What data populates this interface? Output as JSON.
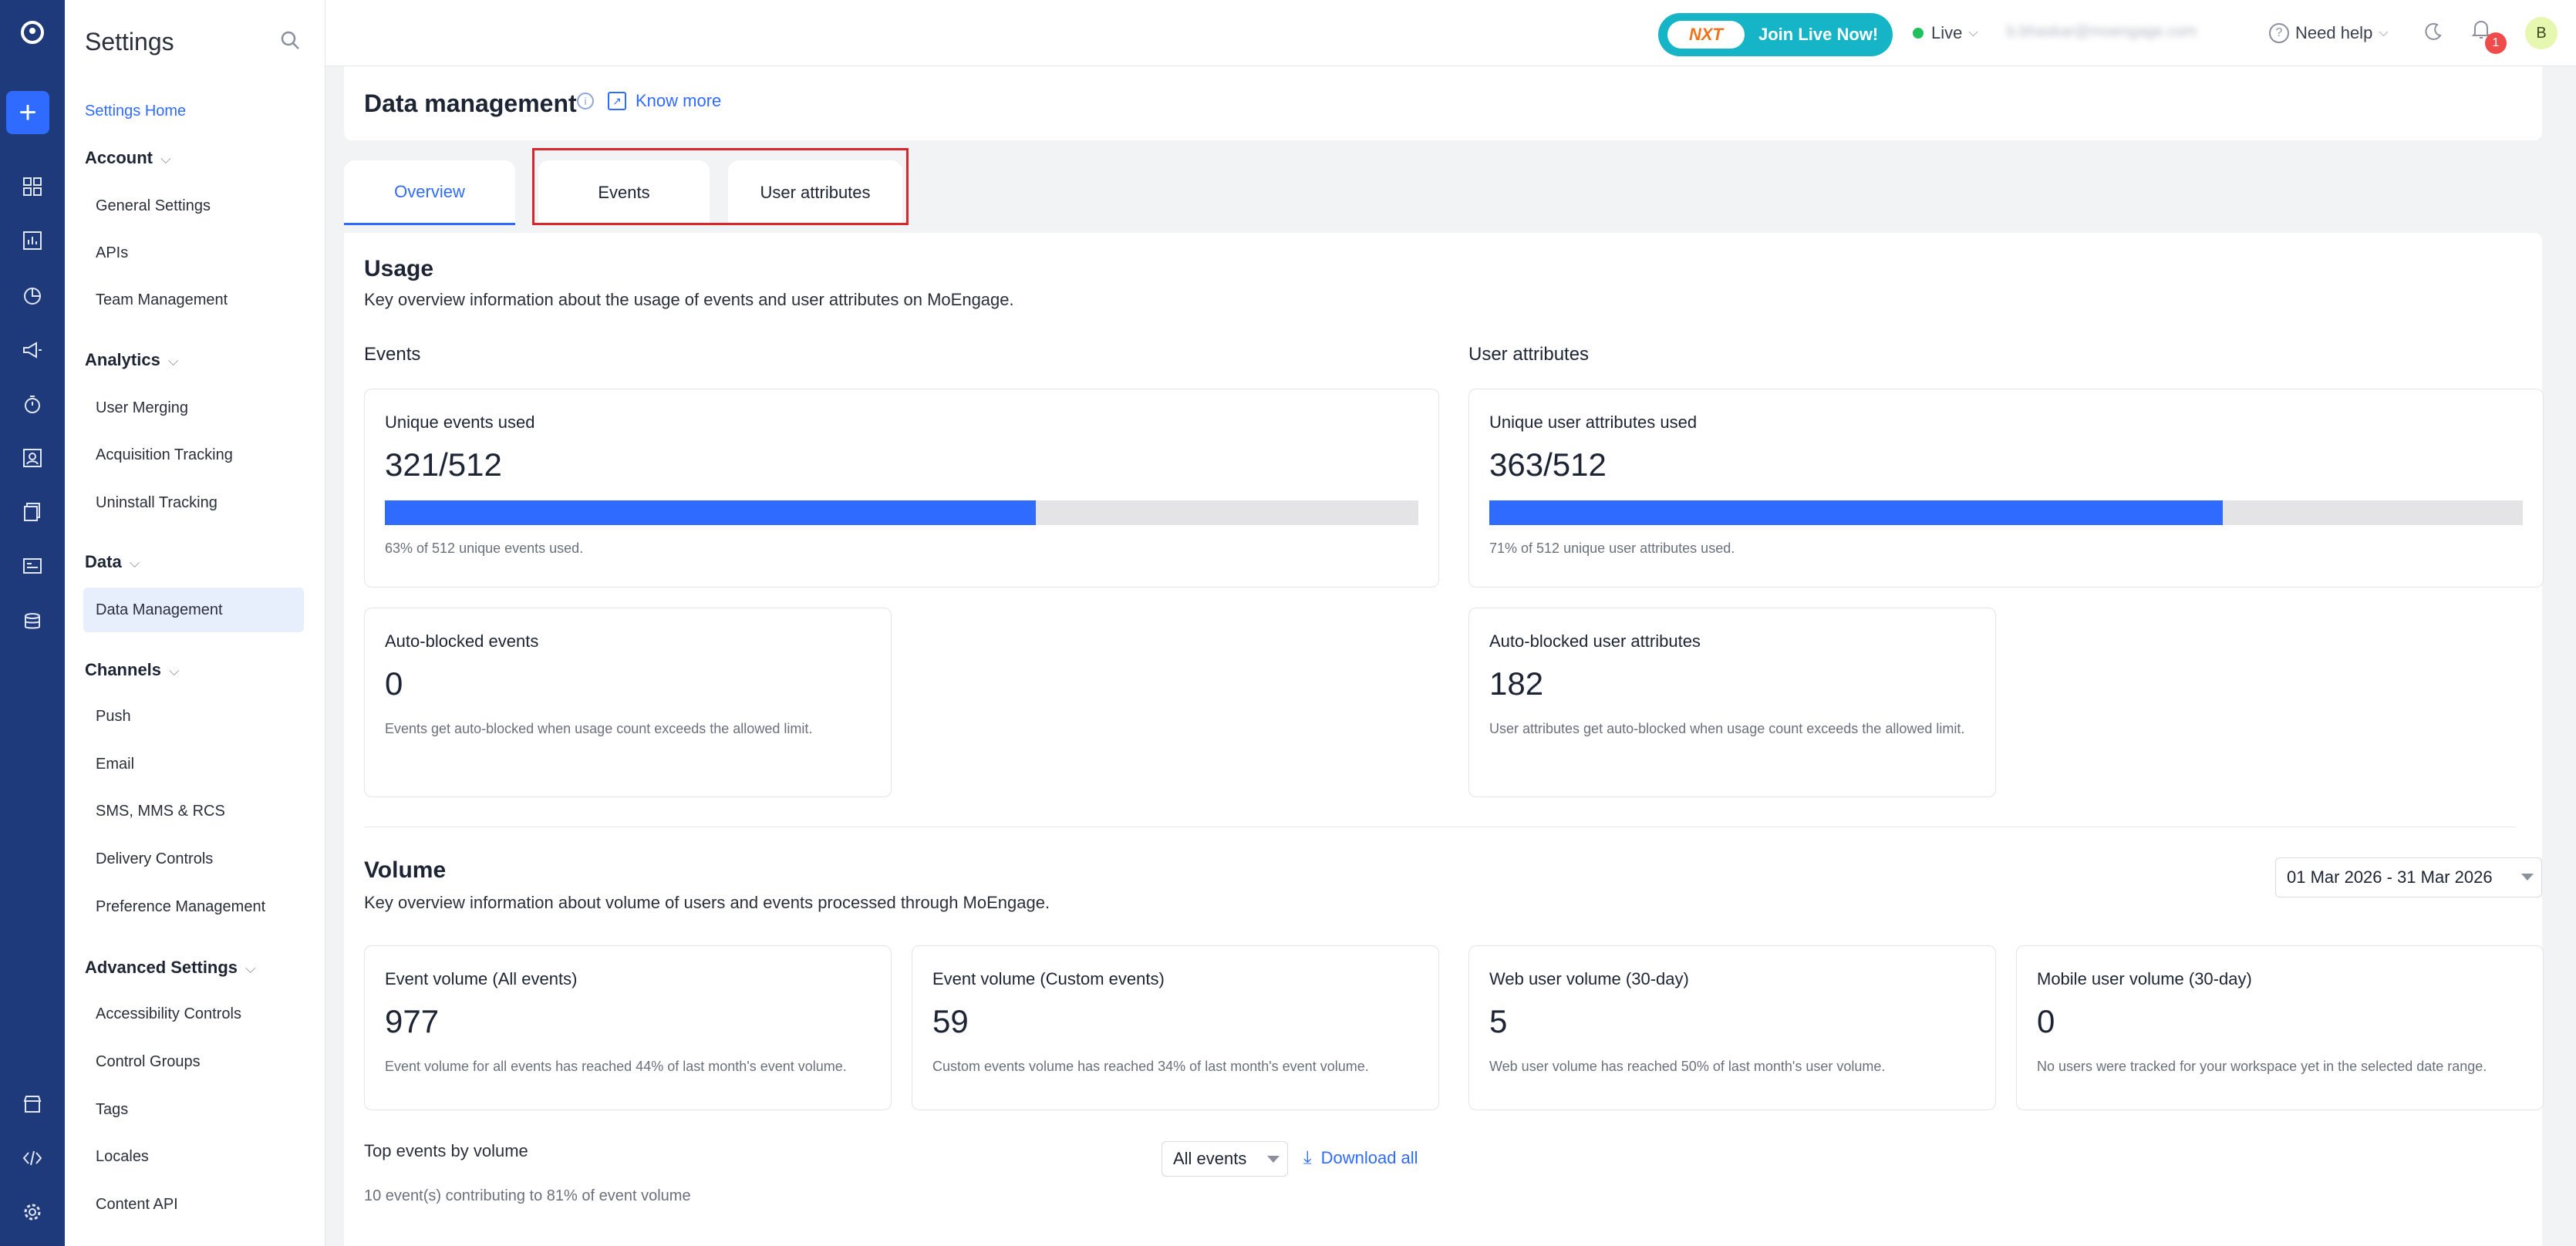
{
  "sidebar": {
    "title": "Settings",
    "home": "Settings Home",
    "sections": [
      {
        "label": "Account",
        "items": [
          "General Settings",
          "APIs",
          "Team Management"
        ]
      },
      {
        "label": "Analytics",
        "items": [
          "User Merging",
          "Acquisition Tracking",
          "Uninstall Tracking"
        ]
      },
      {
        "label": "Data",
        "items": [
          "Data Management"
        ]
      },
      {
        "label": "Channels",
        "items": [
          "Push",
          "Email",
          "SMS, MMS & RCS",
          "Delivery Controls",
          "Preference Management"
        ]
      },
      {
        "label": "Advanced Settings",
        "items": [
          "Accessibility Controls",
          "Control Groups",
          "Tags",
          "Locales",
          "Content API"
        ]
      }
    ]
  },
  "topbar": {
    "next_label": "NXT",
    "join_label": "Join Live Now!",
    "env_label": "Live",
    "account_label": "b.bhaskar@moengage.com",
    "help_label": "Need help",
    "notification_count": "1",
    "avatar_initial": "B"
  },
  "page": {
    "title": "Data management",
    "know_more": "Know more"
  },
  "tabs": [
    "Overview",
    "Events",
    "User attributes"
  ],
  "usage": {
    "title": "Usage",
    "subtitle": "Key overview information about the usage of events and user attributes on MoEngage.",
    "events_heading": "Events",
    "attrs_heading": "User attributes",
    "unique_events": {
      "label": "Unique events used",
      "value": "321/512",
      "fraction": 0.63,
      "note": "63% of 512 unique events used."
    },
    "unique_attrs": {
      "label": "Unique user attributes used",
      "value": "363/512",
      "fraction": 0.71,
      "note": "71% of 512 unique user attributes used."
    },
    "blocked_events": {
      "label": "Auto-blocked events",
      "value": "0",
      "note": "Events get auto-blocked when usage count exceeds the allowed limit."
    },
    "blocked_attrs": {
      "label": "Auto-blocked user attributes",
      "value": "182",
      "note": "User attributes get auto-blocked when usage count exceeds the allowed limit."
    }
  },
  "volume": {
    "title": "Volume",
    "subtitle": "Key overview information about volume of users and events processed through MoEngage.",
    "date_range": "01 Mar 2026 - 31 Mar 2026",
    "cards": [
      {
        "label": "Event volume (All events)",
        "value": "977",
        "note": "Event volume for all events has reached 44% of last month's event volume."
      },
      {
        "label": "Event volume (Custom events)",
        "value": "59",
        "note": "Custom events volume has reached 34% of last month's event volume."
      },
      {
        "label": "Web user volume (30-day)",
        "value": "5",
        "note": "Web user volume has reached 50% of last month's user volume."
      },
      {
        "label": "Mobile user volume (30-day)",
        "value": "0",
        "note": "No users were tracked for your workspace yet in the selected date range."
      }
    ],
    "top_events_title": "Top events by volume",
    "top_events_note": "10 event(s) contributing to 81% of event volume",
    "filter_label": "All events",
    "download_label": "Download all"
  }
}
